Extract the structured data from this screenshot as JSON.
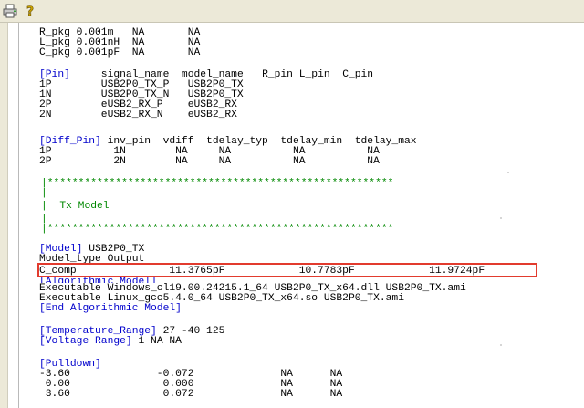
{
  "toolbar": {
    "print_icon": "printer-icon",
    "help_icon": "help-question-icon"
  },
  "colors": {
    "keyword": "#0000cc",
    "comment": "#008800",
    "highlight_border": "#e23b2e",
    "toolbar_bg": "#ece9d8"
  },
  "lines": {
    "l1": "R_pkg 0.001m   NA       NA",
    "l2": "L_pkg 0.001nH  NA       NA",
    "l3": "C_pkg 0.001pF  NA       NA",
    "pin_kw": "[Pin]",
    "pin_hdr": "     signal_name  model_name   R_pin L_pin  C_pin",
    "p1": "1P        USB2P0_TX_P   USB2P0_TX",
    "p2": "1N        USB2P0_TX_N   USB2P0_TX",
    "p3": "2P        eUSB2_RX_P    eUSB2_RX",
    "p4": "2N        eUSB2_RX_N    eUSB2_RX",
    "diff_kw": "[Diff_Pin]",
    "diff_hdr": " inv_pin  vdiff  tdelay_typ  tdelay_min  tdelay_max",
    "d1": "1P          1N        NA     NA          NA          NA",
    "d2": "2P          2N        NA     NA          NA          NA",
    "stars": "|********************************************************",
    "bar_line": "|",
    "tx_model": "|  Tx Model",
    "model_kw": "[Model]",
    "model_name": " USB2P0_TX",
    "model_type": "Model_type Output",
    "c_comp": "C_comp               11.3765pF            10.7783pF            11.9724pF",
    "algo_kw": "[Algorithmic Model]",
    "exec1": "Executable Windows_cl19.00.24215.1_64 USB2P0_TX_x64.dll USB2P0_TX.ami",
    "exec2": "Executable Linux_gcc5.4.0_64 USB2P0_TX_x64.so USB2P0_TX.ami",
    "end_algo_kw": "[End Algorithmic Model]",
    "temp_kw": "[Temperature_Range]",
    "temp_val": " 27 -40 125",
    "volt_kw": "[Voltage Range]",
    "volt_val": " 1 NA NA",
    "pulldown_kw": "[Pulldown]",
    "pd1": "-3.60              -0.072              NA      NA",
    "pd2": " 0.00               0.000              NA      NA",
    "pd3": " 3.60               0.072              NA      NA"
  }
}
